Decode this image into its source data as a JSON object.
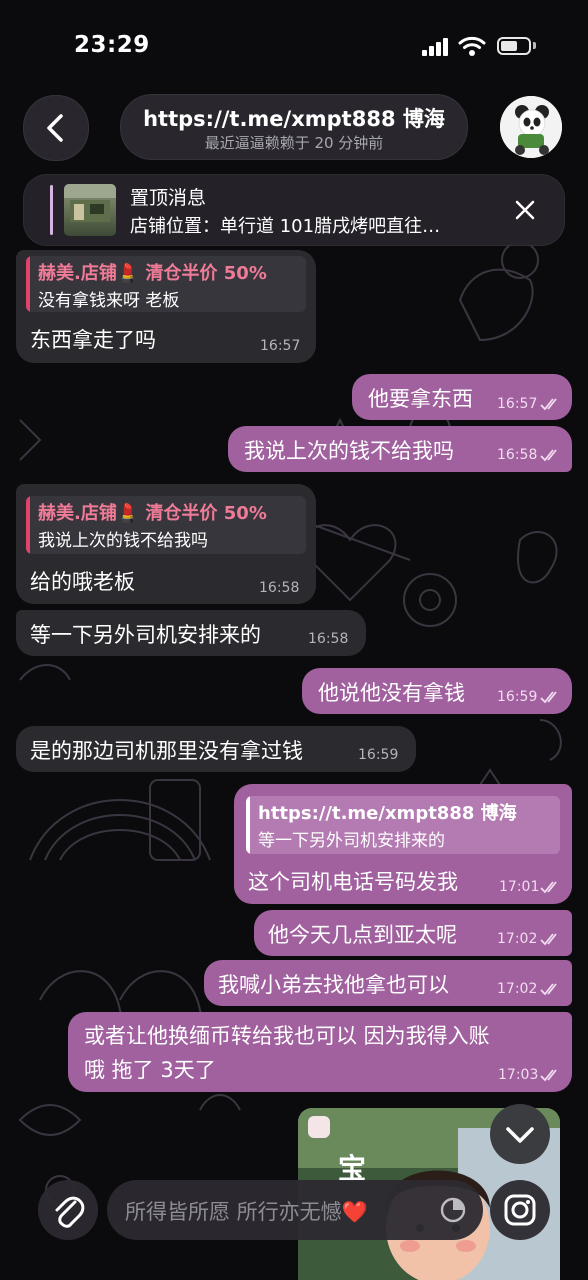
{
  "status_bar": {
    "time": "23:29",
    "battery_level": 0.6
  },
  "header": {
    "title": "https://t.me/xmpt888 博海",
    "subtitle": "最近逼逼赖赖于 20 分钟前",
    "back_icon": "chevron-left-icon",
    "avatar_icon": "panda-avatar"
  },
  "pinned": {
    "title": "置顶消息",
    "text": "店铺位置：单行道 101腊戌烤吧直往…",
    "close_icon": "close-icon"
  },
  "messages": [
    {
      "dir": "in",
      "reply_name": "赫美.店铺💄 清仓半价 50%",
      "reply_text": "没有拿钱来呀 老板",
      "text": "东西拿走了吗",
      "time": "16:57"
    },
    {
      "dir": "out",
      "text": "他要拿东西",
      "time": "16:57"
    },
    {
      "dir": "out",
      "text": "我说上次的钱不给我吗",
      "time": "16:58"
    },
    {
      "dir": "in",
      "reply_name": "赫美.店铺💄 清仓半价 50%",
      "reply_text": "我说上次的钱不给我吗",
      "text": "给的哦老板",
      "time": "16:58"
    },
    {
      "dir": "in",
      "text": "等一下另外司机安排来的",
      "time": "16:58"
    },
    {
      "dir": "out",
      "text": "他说他没有拿钱",
      "time": "16:59"
    },
    {
      "dir": "in",
      "text": "是的那边司机那里没有拿过钱",
      "time": "16:59"
    },
    {
      "dir": "out",
      "reply_name": "https://t.me/xmpt888 博海",
      "reply_text": "等一下另外司机安排来的",
      "text": "这个司机电话号码发我",
      "time": "17:01"
    },
    {
      "dir": "out",
      "text": "他今天几点到亚太呢",
      "time": "17:02"
    },
    {
      "dir": "out",
      "text": "我喊小弟去找他拿也可以",
      "time": "17:02"
    },
    {
      "dir": "out",
      "text": "或者让他换缅币转给我也可以 因为我得入账",
      "text2": "哦 拖了 3天了",
      "time": "17:03"
    }
  ],
  "composer": {
    "placeholder": "所得皆所愿 所行亦无憾❤️",
    "attach_icon": "paperclip-icon",
    "sticker_icon": "sticker-icon",
    "camera_icon": "instagram-camera-icon",
    "scroll_icon": "chevron-down-icon"
  },
  "colors": {
    "outgoing": "#a1619f",
    "incoming": "#2b2a2e",
    "reply_name": "#f07b97"
  }
}
